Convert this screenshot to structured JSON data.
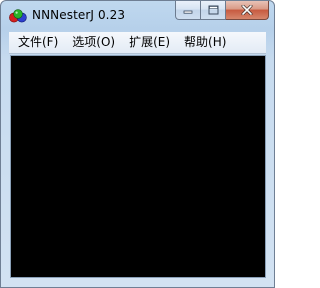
{
  "window": {
    "title": "NNNesterJ 0.23",
    "app_icon": "three-balls-icon"
  },
  "caption_buttons": {
    "minimize_icon": "minimize-icon",
    "maximize_icon": "maximize-icon",
    "close_icon": "close-icon"
  },
  "menubar": {
    "items": [
      {
        "label": "文件(F)"
      },
      {
        "label": "选项(O)"
      },
      {
        "label": "扩展(E)"
      },
      {
        "label": "帮助(H)"
      }
    ]
  },
  "colors": {
    "client_background": "#000000",
    "titlebar": "#bfd8ef",
    "close_button": "#c75a40"
  }
}
